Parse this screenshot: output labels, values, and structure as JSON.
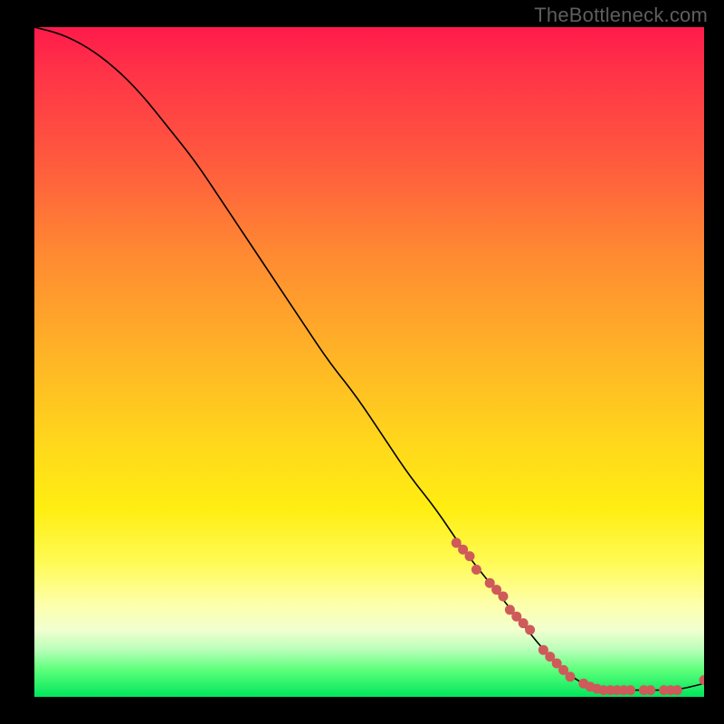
{
  "watermark": "TheBottleneck.com",
  "colors": {
    "dot": "#cf5a5a",
    "curve": "#000000",
    "gradient_top": "#ff1a4b",
    "gradient_bottom": "#00e65c"
  },
  "chart_data": {
    "type": "line",
    "title": "",
    "xlabel": "",
    "ylabel": "",
    "xlim": [
      0,
      100
    ],
    "ylim": [
      0,
      100
    ],
    "grid": false,
    "legend": false,
    "series": [
      {
        "name": "bottleneck-curve",
        "x": [
          0,
          4,
          8,
          12,
          16,
          20,
          24,
          28,
          32,
          36,
          40,
          44,
          48,
          52,
          56,
          60,
          64,
          68,
          72,
          76,
          80,
          84,
          88,
          92,
          96,
          100
        ],
        "y": [
          100,
          99,
          97,
          94,
          90,
          85,
          80,
          74,
          68,
          62,
          56,
          50,
          45,
          39,
          33,
          28,
          22,
          17,
          12,
          7,
          3,
          1,
          1,
          1,
          1,
          2
        ]
      }
    ],
    "markers": {
      "name": "highlighted-points",
      "points": [
        {
          "x": 63,
          "y": 23
        },
        {
          "x": 64,
          "y": 22
        },
        {
          "x": 65,
          "y": 21
        },
        {
          "x": 66,
          "y": 19
        },
        {
          "x": 68,
          "y": 17
        },
        {
          "x": 69,
          "y": 16
        },
        {
          "x": 70,
          "y": 15
        },
        {
          "x": 71,
          "y": 13
        },
        {
          "x": 72,
          "y": 12
        },
        {
          "x": 73,
          "y": 11
        },
        {
          "x": 74,
          "y": 10
        },
        {
          "x": 76,
          "y": 7
        },
        {
          "x": 77,
          "y": 6
        },
        {
          "x": 78,
          "y": 5
        },
        {
          "x": 79,
          "y": 4
        },
        {
          "x": 80,
          "y": 3
        },
        {
          "x": 82,
          "y": 2
        },
        {
          "x": 83,
          "y": 1.5
        },
        {
          "x": 84,
          "y": 1.2
        },
        {
          "x": 85,
          "y": 1
        },
        {
          "x": 86,
          "y": 1
        },
        {
          "x": 87,
          "y": 1
        },
        {
          "x": 88,
          "y": 1
        },
        {
          "x": 89,
          "y": 1
        },
        {
          "x": 91,
          "y": 1
        },
        {
          "x": 92,
          "y": 1
        },
        {
          "x": 94,
          "y": 1
        },
        {
          "x": 95,
          "y": 1
        },
        {
          "x": 96,
          "y": 1
        },
        {
          "x": 100,
          "y": 2.5
        }
      ]
    }
  }
}
